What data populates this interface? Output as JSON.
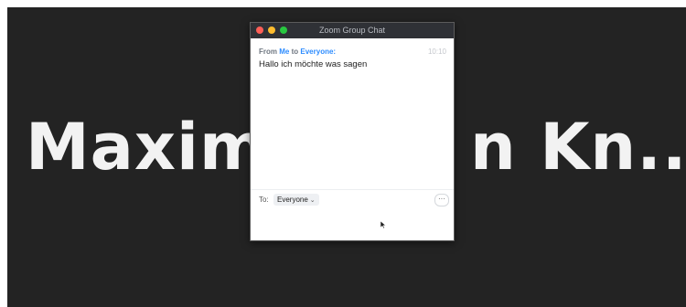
{
  "meeting": {
    "participant_name": "Maxim",
    "participant_name_tail": "n Kn..."
  },
  "chat": {
    "window_title": "Zoom Group Chat",
    "message": {
      "from_label": "From",
      "sender": "Me",
      "to_label": "to",
      "recipient": "Everyone:",
      "time": "10:10",
      "text": "Hallo ich möchte was sagen"
    },
    "composer": {
      "to_prefix": "To:",
      "recipient_select": "Everyone",
      "more_label": "···"
    }
  },
  "colors": {
    "stage_bg": "#232323",
    "accent": "#2d8cff",
    "titlebar": "#2f3136"
  }
}
